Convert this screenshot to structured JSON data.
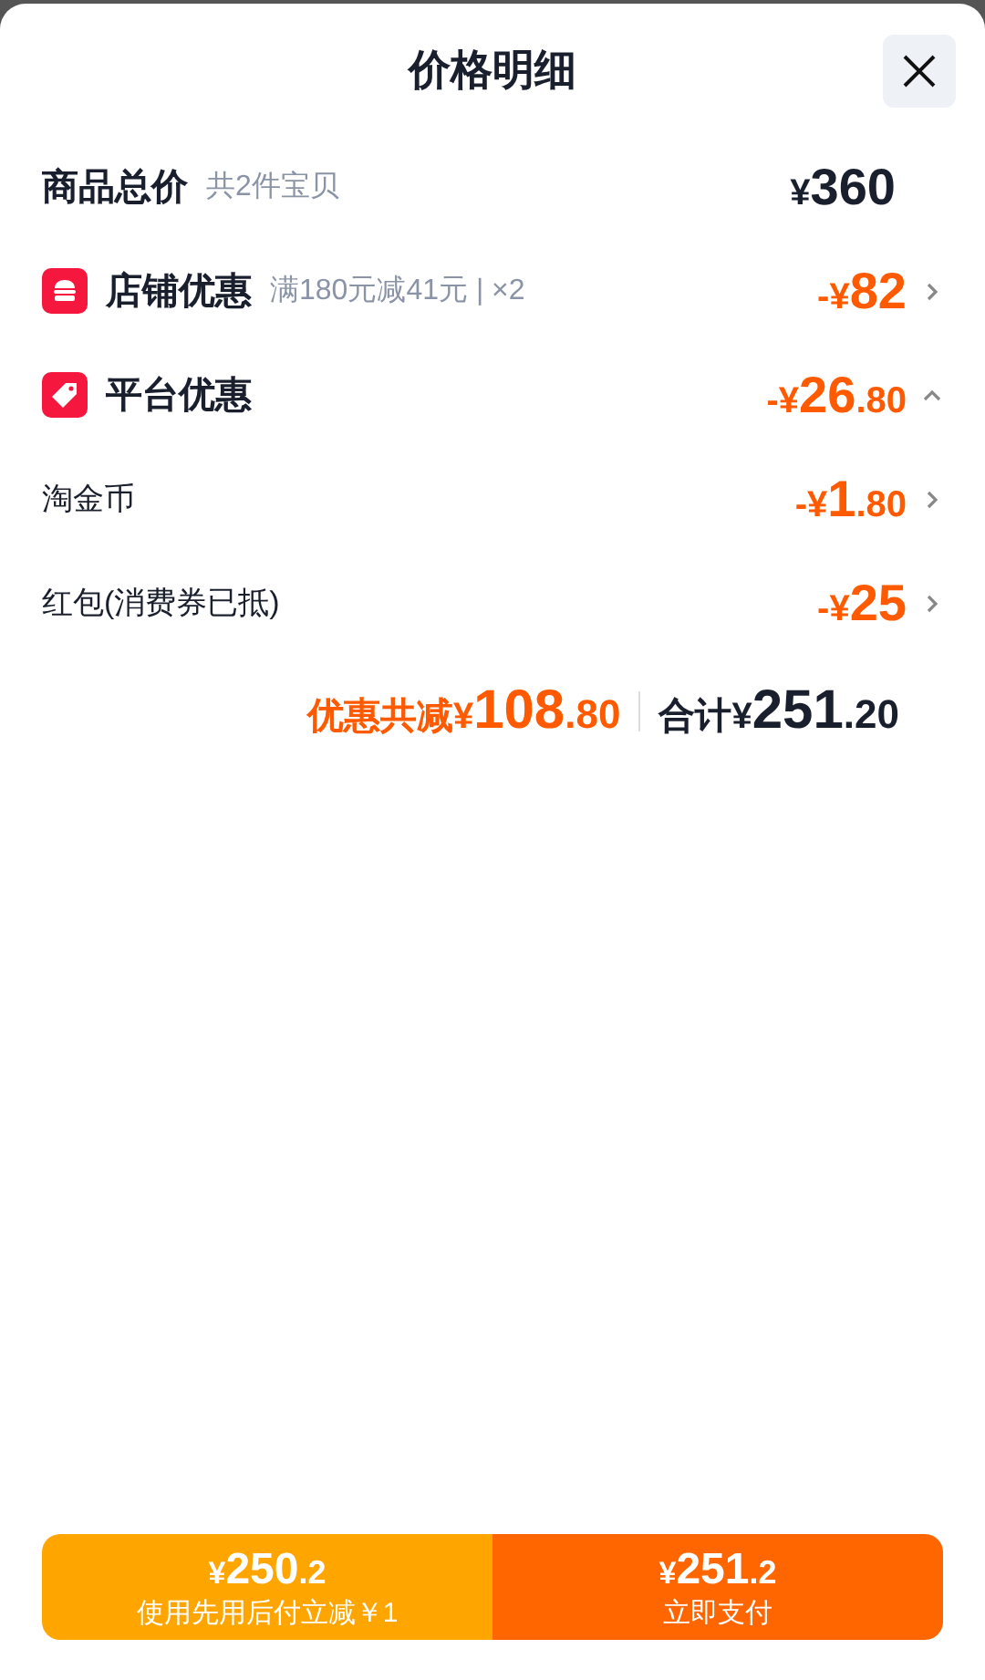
{
  "header": {
    "title": "价格明细"
  },
  "rows": [
    {
      "kind": "total",
      "label": "商品总价",
      "note": "共2件宝贝",
      "price": {
        "prefix": "¥",
        "int": "360"
      }
    },
    {
      "kind": "store",
      "label": "店铺优惠",
      "note": "满180元减41元 | ×2",
      "price": {
        "prefix": "-¥",
        "int": "82"
      },
      "expanded": false
    },
    {
      "kind": "platform",
      "label": "平台优惠",
      "price": {
        "prefix": "-¥",
        "int": "26",
        "dec": ".80"
      },
      "expanded": true
    },
    {
      "kind": "plain",
      "label": "淘金币",
      "price": {
        "prefix": "-¥",
        "int": "1",
        "dec": ".80"
      },
      "expanded": false
    },
    {
      "kind": "plain",
      "label": "红包(消费券已抵)",
      "price": {
        "prefix": "-¥",
        "int": "25"
      },
      "expanded": false
    }
  ],
  "summary": {
    "discount_label": "优惠共减¥",
    "discount": {
      "int": "108",
      "dec": ".80"
    },
    "total_label": "合计¥",
    "total": {
      "int": "251",
      "dec": ".20"
    }
  },
  "buttons": [
    {
      "kind": "later",
      "price": {
        "prefix": "¥",
        "int": "250",
        "dec": ".2"
      },
      "label": "使用先用后付立减￥1"
    },
    {
      "kind": "now",
      "price": {
        "prefix": "¥",
        "int": "251",
        "dec": ".2"
      },
      "label": "立即支付"
    }
  ]
}
